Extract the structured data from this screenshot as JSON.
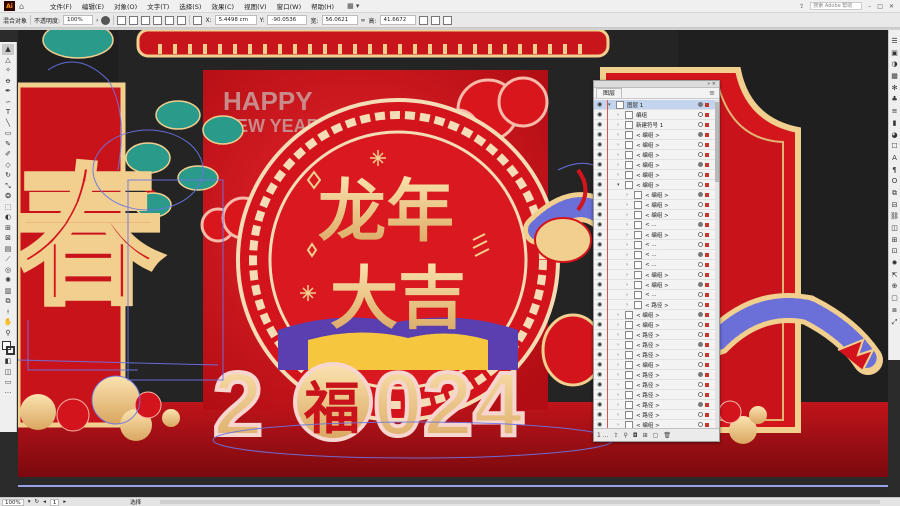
{
  "app": {
    "logo": "Ai",
    "home_icon": "home-icon"
  },
  "menu": [
    "文件(F)",
    "编辑(E)",
    "对象(O)",
    "文字(T)",
    "选择(S)",
    "效果(C)",
    "视图(V)",
    "窗口(W)",
    "帮助(H)"
  ],
  "menubar_right": {
    "search": "搜索 Adobe 帮助"
  },
  "control": {
    "selection": "混合对象",
    "opacity_label": "不透明度:",
    "opacity_value": "100%",
    "x_label": "X:",
    "x_value": "5.4498 cm",
    "y_label": "Y:",
    "y_value": "-90.0536",
    "w_label": "宽:",
    "w_value": "56.0621",
    "h_label": "高:",
    "h_value": "41.6672"
  },
  "layers_panel": {
    "tab": "图层",
    "rows": [
      {
        "name": "图层 1",
        "indent": 0,
        "expanded": true,
        "top": true
      },
      {
        "name": "编组",
        "indent": 1,
        "expanded": false
      },
      {
        "name": "新建符号 1",
        "indent": 1,
        "expanded": false
      },
      {
        "name": "< 编组 >",
        "indent": 1,
        "expanded": false
      },
      {
        "name": "< 编组 >",
        "indent": 1,
        "expanded": false
      },
      {
        "name": "< 编组 >",
        "indent": 1,
        "expanded": false
      },
      {
        "name": "< 编组 >",
        "indent": 1,
        "expanded": false
      },
      {
        "name": "< 编组 >",
        "indent": 1,
        "expanded": false
      },
      {
        "name": "< 编组 >",
        "indent": 1,
        "expanded": true
      },
      {
        "name": "< 编组 >",
        "indent": 2,
        "expanded": false
      },
      {
        "name": "< 编组 >",
        "indent": 2,
        "expanded": false
      },
      {
        "name": "< 编组 >",
        "indent": 2,
        "expanded": false
      },
      {
        "name": "< ...",
        "indent": 2,
        "expanded": false
      },
      {
        "name": "< 编组 >",
        "indent": 2,
        "expanded": false
      },
      {
        "name": "< ...",
        "indent": 2,
        "expanded": false
      },
      {
        "name": "< ...",
        "indent": 2,
        "expanded": false
      },
      {
        "name": "< ...",
        "indent": 2,
        "expanded": false
      },
      {
        "name": "< 编组 >",
        "indent": 2,
        "expanded": false
      },
      {
        "name": "< 编组 >",
        "indent": 2,
        "expanded": false
      },
      {
        "name": "< ...",
        "indent": 2,
        "expanded": false
      },
      {
        "name": "< 路径 >",
        "indent": 2,
        "expanded": false
      },
      {
        "name": "< 编组 >",
        "indent": 1,
        "expanded": false
      },
      {
        "name": "< 编组 >",
        "indent": 1,
        "expanded": false
      },
      {
        "name": "< 路径 >",
        "indent": 1,
        "expanded": false
      },
      {
        "name": "< 路径 >",
        "indent": 1,
        "expanded": false
      },
      {
        "name": "< 路径 >",
        "indent": 1,
        "expanded": false
      },
      {
        "name": "< 编组 >",
        "indent": 1,
        "expanded": false
      },
      {
        "name": "< 路径 >",
        "indent": 1,
        "expanded": false
      },
      {
        "name": "< 路径 >",
        "indent": 1,
        "expanded": false
      },
      {
        "name": "< 路径 >",
        "indent": 1,
        "expanded": false
      },
      {
        "name": "< 路径 >",
        "indent": 1,
        "expanded": false
      },
      {
        "name": "< 路径 >",
        "indent": 1,
        "expanded": false
      },
      {
        "name": "< 编组 >",
        "indent": 1,
        "expanded": false
      }
    ],
    "footer_count": "1 ..."
  },
  "artwork": {
    "happy": "HAPPY",
    "new_year": "NEW YEAR",
    "line1": "龙年",
    "line2": "大吉",
    "year_left": "2",
    "fu": "福",
    "year_right": "024",
    "spring": "春"
  },
  "status": {
    "zoom": "100%",
    "artboard": "1",
    "mode": "选择"
  },
  "colors": {
    "red": "#d4141c",
    "gold": "#f0cf8f",
    "teal": "#2a9a8a",
    "purple": "#5a3fb0"
  }
}
